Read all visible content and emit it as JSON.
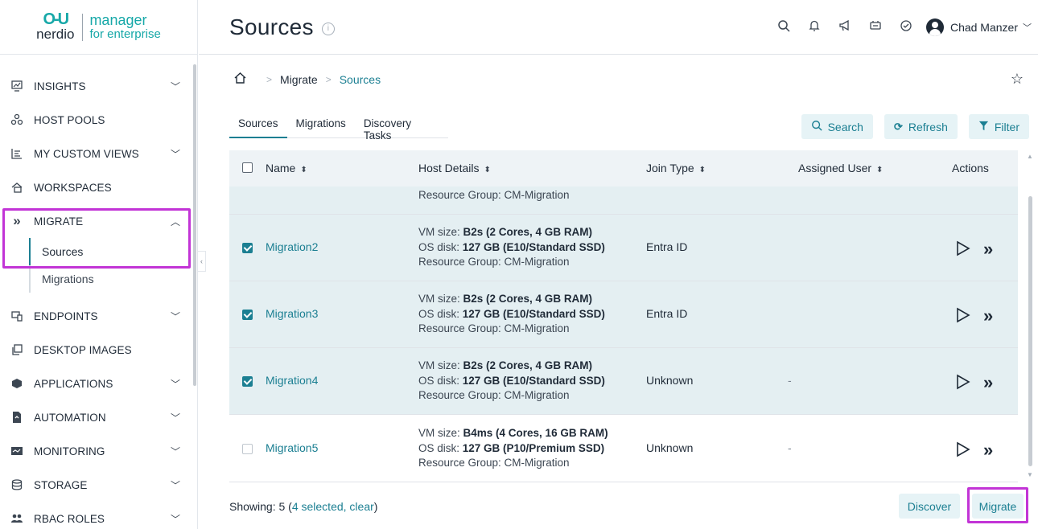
{
  "brand": {
    "logo_glyph": "O-U",
    "logo_word": "nerdio",
    "product_line1": "manager",
    "product_line2": "for enterprise"
  },
  "sidebar": {
    "items": [
      {
        "label": "INSIGHTS",
        "icon": "insights-icon",
        "chevron": "down"
      },
      {
        "label": "HOST POOLS",
        "icon": "host-pools-icon",
        "chevron": ""
      },
      {
        "label": "MY CUSTOM VIEWS",
        "icon": "custom-views-icon",
        "chevron": "down"
      },
      {
        "label": "WORKSPACES",
        "icon": "workspaces-icon",
        "chevron": ""
      },
      {
        "label": "MIGRATE",
        "icon": "migrate-icon",
        "chevron": "up"
      },
      {
        "label": "ENDPOINTS",
        "icon": "endpoints-icon",
        "chevron": "down"
      },
      {
        "label": "DESKTOP IMAGES",
        "icon": "desktop-images-icon",
        "chevron": ""
      },
      {
        "label": "APPLICATIONS",
        "icon": "applications-icon",
        "chevron": "down"
      },
      {
        "label": "AUTOMATION",
        "icon": "automation-icon",
        "chevron": "down"
      },
      {
        "label": "MONITORING",
        "icon": "monitoring-icon",
        "chevron": "down"
      },
      {
        "label": "STORAGE",
        "icon": "storage-icon",
        "chevron": "down"
      },
      {
        "label": "RBAC ROLES",
        "icon": "rbac-roles-icon",
        "chevron": "down"
      }
    ],
    "migrate_sub": [
      {
        "label": "Sources",
        "active": true
      },
      {
        "label": "Migrations",
        "active": false
      }
    ],
    "highlight_color": "#c234d6"
  },
  "header": {
    "title": "Sources",
    "user_name": "Chad Manzer",
    "icons": [
      "search-icon",
      "bell-icon",
      "megaphone-icon",
      "support-icon",
      "check-circle-icon"
    ]
  },
  "breadcrumb": {
    "items": [
      "Migrate",
      "Sources"
    ]
  },
  "tabs": [
    "Sources",
    "Migrations",
    "Discovery Tasks"
  ],
  "toolbar": {
    "search": "Search",
    "refresh": "Refresh",
    "filter": "Filter"
  },
  "table": {
    "columns": {
      "name": "Name",
      "host": "Host Details",
      "join": "Join Type",
      "user": "Assigned User",
      "actions": "Actions"
    },
    "partial_row": {
      "host_line3": "Resource Group: CM-Migration"
    },
    "rows": [
      {
        "name": "Migration2",
        "selected": true,
        "vm_label": "VM size: ",
        "vm": "B2s (2 Cores, 4 GB RAM)",
        "disk_label": "OS disk: ",
        "disk": "127 GB (E10/Standard SSD)",
        "rg": "Resource Group: CM-Migration",
        "join": "Entra ID",
        "user": ""
      },
      {
        "name": "Migration3",
        "selected": true,
        "vm_label": "VM size: ",
        "vm": "B2s (2 Cores, 4 GB RAM)",
        "disk_label": "OS disk: ",
        "disk": "127 GB (E10/Standard SSD)",
        "rg": "Resource Group: CM-Migration",
        "join": "Entra ID",
        "user": ""
      },
      {
        "name": "Migration4",
        "selected": true,
        "vm_label": "VM size: ",
        "vm": "B2s (2 Cores, 4 GB RAM)",
        "disk_label": "OS disk: ",
        "disk": "127 GB (E10/Standard SSD)",
        "rg": "Resource Group: CM-Migration",
        "join": "Unknown",
        "user": "-"
      },
      {
        "name": "Migration5",
        "selected": false,
        "vm_label": "VM size: ",
        "vm": "B4ms (4 Cores, 16 GB RAM)",
        "disk_label": "OS disk: ",
        "disk": "127 GB (P10/Premium SSD)",
        "rg": "Resource Group: CM-Migration",
        "join": "Unknown",
        "user": "-"
      }
    ]
  },
  "footer": {
    "showing_prefix": "Showing: 5 (",
    "selected_text": "4 selected, clear",
    "showing_suffix": ")",
    "discover": "Discover",
    "migrate": "Migrate"
  },
  "colors": {
    "accent": "#1b7f92",
    "selected_row": "#e4eff2",
    "button_bg": "#e6f3f6"
  }
}
